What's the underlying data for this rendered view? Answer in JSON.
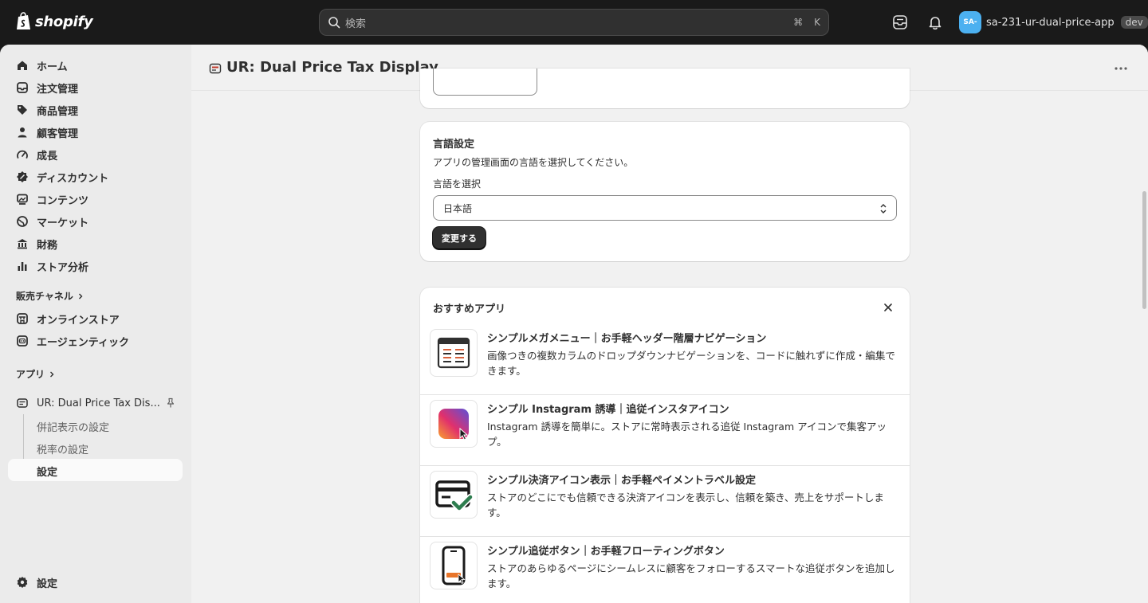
{
  "topbar": {
    "logo_text": "shopify",
    "search_placeholder": "検索",
    "kbd_cmd": "⌘",
    "kbd_key": "K",
    "shop_initials": "SA-",
    "shop_name": "sa-231-ur-dual-price-app",
    "dev_badge": "dev"
  },
  "sidebar": {
    "items": [
      {
        "label": "ホーム",
        "icon": "home-icon"
      },
      {
        "label": "注文管理",
        "icon": "inbox-icon"
      },
      {
        "label": "商品管理",
        "icon": "tag-icon"
      },
      {
        "label": "顧客管理",
        "icon": "person-icon"
      },
      {
        "label": "成長",
        "icon": "gauge-icon"
      },
      {
        "label": "ディスカウント",
        "icon": "discount-icon"
      },
      {
        "label": "コンテンツ",
        "icon": "image-icon"
      },
      {
        "label": "マーケット",
        "icon": "globe-icon"
      },
      {
        "label": "財務",
        "icon": "bank-icon"
      },
      {
        "label": "ストア分析",
        "icon": "chart-icon"
      }
    ],
    "sales_channels_label": "販売チャネル",
    "channels": [
      {
        "label": "オンラインストア",
        "icon": "store-icon"
      },
      {
        "label": "エージェンティック",
        "icon": "robot-icon"
      }
    ],
    "apps_label": "アプリ",
    "app_name": "UR: Dual Price Tax Dis...",
    "app_subitems": [
      "併記表示の設定",
      "税率の設定",
      "設定"
    ],
    "settings_label": "設定"
  },
  "header": {
    "title": "UR: Dual Price Tax Display"
  },
  "language_card": {
    "title": "言語設定",
    "description": "アプリの管理画面の言語を選択してください。",
    "select_label": "言語を選択",
    "selected_value": "日本語",
    "submit_label": "変更する"
  },
  "recommended": {
    "title": "おすすめアプリ",
    "apps": [
      {
        "name": "シンプルメガメニュー｜お手軽ヘッダー階層ナビゲーション",
        "description": "画像つきの複数カラムのドロップダウンナビゲーションを、コードに触れずに作成・編集できます。",
        "icon": "mega-menu-icon"
      },
      {
        "name": "シンプル Instagram 誘導｜追従インスタアイコン",
        "description": "Instagram 誘導を簡単に。ストアに常時表示される追従 Instagram アイコンで集客アップ。",
        "icon": "instagram-icon"
      },
      {
        "name": "シンプル決済アイコン表示｜お手軽ペイメントラベル設定",
        "description": "ストアのどこにでも信頼できる決済アイコンを表示し、信頼を築き、売上をサポートします。",
        "icon": "payment-card-icon"
      },
      {
        "name": "シンプル追従ボタン｜お手軽フローティングボタン",
        "description": "ストアのあらゆるページにシームレスに顧客をフォローするスマートな追従ボタンを追加します。",
        "icon": "phone-button-icon"
      }
    ]
  }
}
